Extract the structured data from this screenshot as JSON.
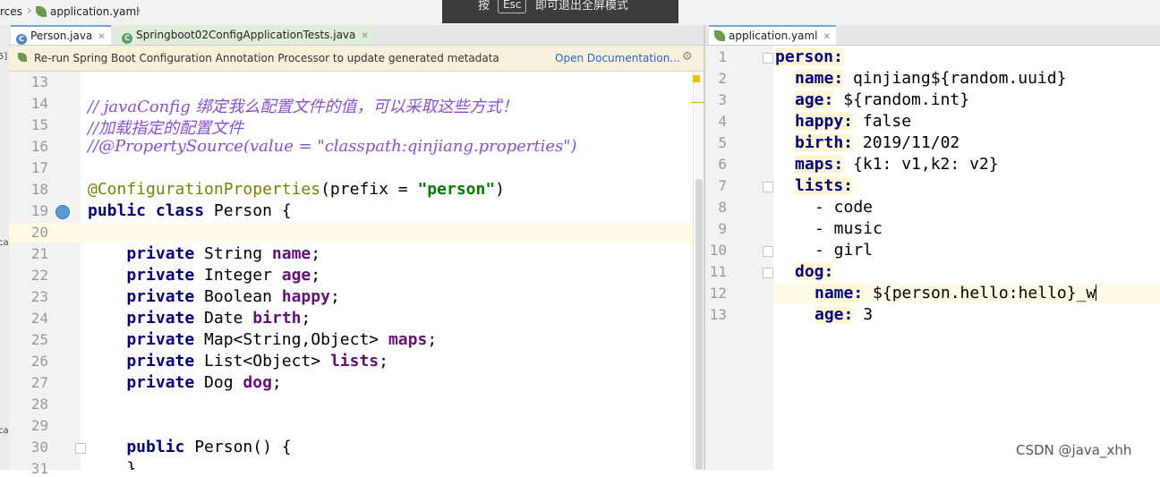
{
  "breadcrumb": {
    "items": [
      "rces",
      "application.yaml"
    ]
  },
  "fullscreen_toast": {
    "prefix": "按",
    "key": "Esc",
    "suffix": "即可退出全屏模式"
  },
  "left_editor": {
    "tabs": [
      {
        "label": "Person.java",
        "active": true
      },
      {
        "label": "Springboot02ConfigApplicationTests.java",
        "active": false
      }
    ],
    "banner": {
      "message": "Re-run Spring Boot Configuration Annotation Processor to update generated metadata",
      "link": "Open Documentation..."
    },
    "side_strip": [
      "5]",
      "ca",
      "ca"
    ],
    "lines": [
      {
        "num": "13",
        "tokens": []
      },
      {
        "num": "14",
        "tokens": [
          {
            "t": "// javaConfig 绑定我么配置文件的值，可以采取这些方式！",
            "c": "cm"
          }
        ]
      },
      {
        "num": "15",
        "tokens": [
          {
            "t": "//加载指定的配置文件",
            "c": "cm"
          }
        ]
      },
      {
        "num": "16",
        "tokens": [
          {
            "t": "//@PropertySource(value = \"classpath:qinjiang.properties\")",
            "c": "cm"
          }
        ]
      },
      {
        "num": "17",
        "tokens": []
      },
      {
        "num": "18",
        "tokens": [
          {
            "t": "@ConfigurationProperties",
            "c": "ann"
          },
          {
            "t": "(prefix = ",
            "c": ""
          },
          {
            "t": "\"person\"",
            "c": "str"
          },
          {
            "t": ")",
            "c": ""
          }
        ]
      },
      {
        "num": "19",
        "tokens": [
          {
            "t": "public class ",
            "c": "kw"
          },
          {
            "t": "Person {",
            "c": ""
          }
        ]
      },
      {
        "num": "20",
        "tokens": []
      },
      {
        "num": "21",
        "tokens": [
          {
            "t": "    private ",
            "c": "kw"
          },
          {
            "t": "String ",
            "c": ""
          },
          {
            "t": "name",
            "c": "fld"
          },
          {
            "t": ";",
            "c": ""
          }
        ]
      },
      {
        "num": "22",
        "tokens": [
          {
            "t": "    private ",
            "c": "kw"
          },
          {
            "t": "Integer ",
            "c": ""
          },
          {
            "t": "age",
            "c": "fld"
          },
          {
            "t": ";",
            "c": ""
          }
        ]
      },
      {
        "num": "23",
        "tokens": [
          {
            "t": "    private ",
            "c": "kw"
          },
          {
            "t": "Boolean ",
            "c": ""
          },
          {
            "t": "happy",
            "c": "fld"
          },
          {
            "t": ";",
            "c": ""
          }
        ]
      },
      {
        "num": "24",
        "tokens": [
          {
            "t": "    private ",
            "c": "kw"
          },
          {
            "t": "Date ",
            "c": ""
          },
          {
            "t": "birth",
            "c": "fld"
          },
          {
            "t": ";",
            "c": ""
          }
        ]
      },
      {
        "num": "25",
        "tokens": [
          {
            "t": "    private ",
            "c": "kw"
          },
          {
            "t": "Map<String,Object> ",
            "c": ""
          },
          {
            "t": "maps",
            "c": "fld"
          },
          {
            "t": ";",
            "c": ""
          }
        ]
      },
      {
        "num": "26",
        "tokens": [
          {
            "t": "    private ",
            "c": "kw"
          },
          {
            "t": "List<Object> ",
            "c": ""
          },
          {
            "t": "lists",
            "c": "fld"
          },
          {
            "t": ";",
            "c": ""
          }
        ]
      },
      {
        "num": "27",
        "tokens": [
          {
            "t": "    private ",
            "c": "kw"
          },
          {
            "t": "Dog ",
            "c": ""
          },
          {
            "t": "dog",
            "c": "fld"
          },
          {
            "t": ";",
            "c": ""
          }
        ]
      },
      {
        "num": "28",
        "tokens": []
      },
      {
        "num": "29",
        "tokens": []
      },
      {
        "num": "30",
        "tokens": [
          {
            "t": "    public ",
            "c": "kw"
          },
          {
            "t": "Person() {",
            "c": ""
          }
        ]
      },
      {
        "num": "31",
        "tokens": [
          {
            "t": "    }",
            "c": ""
          }
        ]
      }
    ]
  },
  "right_editor": {
    "tab": "application.yaml",
    "lines": [
      {
        "num": "1",
        "indent": 0,
        "key": "person:",
        "value": ""
      },
      {
        "num": "2",
        "indent": 1,
        "key": "name:",
        "value": " qinjiang${random.uuid}"
      },
      {
        "num": "3",
        "indent": 1,
        "key": "age:",
        "value": " ${random.int}"
      },
      {
        "num": "4",
        "indent": 1,
        "key": "happy:",
        "value": " false"
      },
      {
        "num": "5",
        "indent": 1,
        "key": "birth:",
        "value": " 2019/11/02"
      },
      {
        "num": "6",
        "indent": 1,
        "key": "maps:",
        "value": " {k1: v1,k2: v2}"
      },
      {
        "num": "7",
        "indent": 1,
        "key": "lists:",
        "value": ""
      },
      {
        "num": "8",
        "indent": 2,
        "key": "",
        "value": "- code"
      },
      {
        "num": "9",
        "indent": 2,
        "key": "",
        "value": "- music"
      },
      {
        "num": "10",
        "indent": 2,
        "key": "",
        "value": "- girl"
      },
      {
        "num": "11",
        "indent": 1,
        "key": "dog:",
        "value": ""
      },
      {
        "num": "12",
        "indent": 2,
        "key": "name:",
        "value": " ${person.hello:hello}_w"
      },
      {
        "num": "13",
        "indent": 2,
        "key": "age:",
        "value": " 3"
      }
    ]
  },
  "watermark": "CSDN @java_xhh",
  "colors": {
    "keyword": "#000080",
    "string": "#008000",
    "field": "#660e7a",
    "comment": "#8a4fd6",
    "annotation": "#808000",
    "banner_bg": "#f7f1dc",
    "current_line": "#fffbe6"
  }
}
